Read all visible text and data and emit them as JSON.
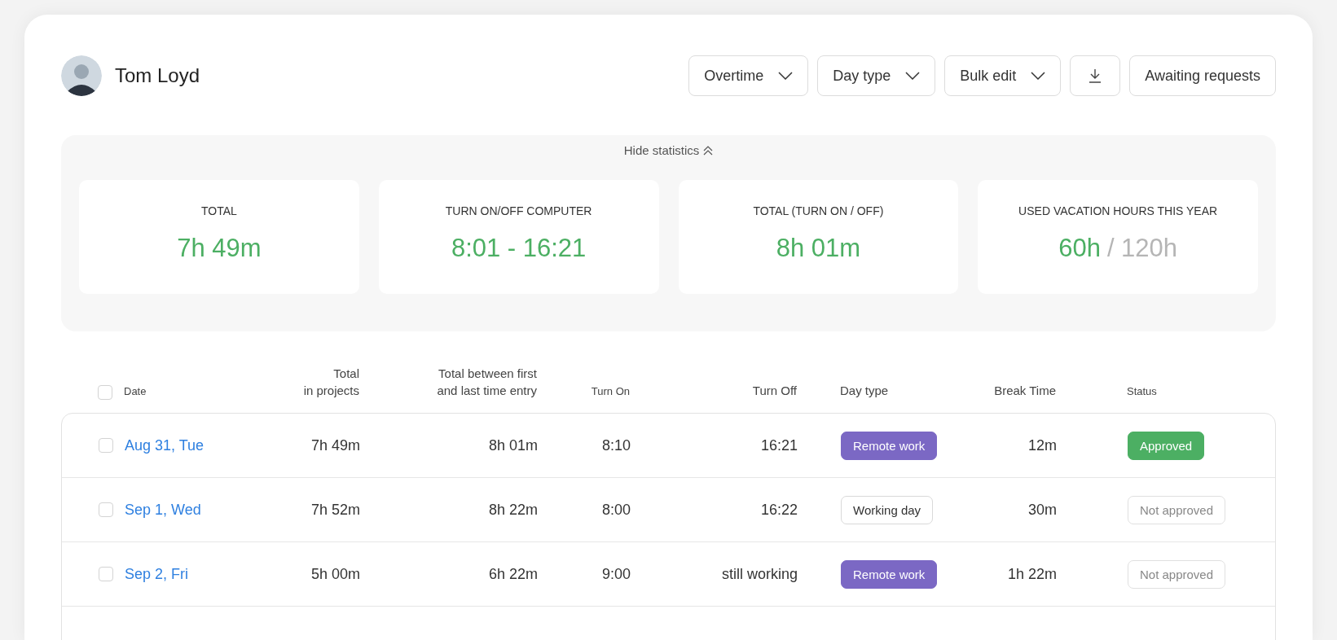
{
  "user": {
    "name": "Tom Loyd"
  },
  "toolbar": [
    {
      "kind": "dropdown",
      "label": "Overtime"
    },
    {
      "kind": "dropdown",
      "label": "Day type"
    },
    {
      "kind": "dropdown",
      "label": "Bulk edit"
    },
    {
      "kind": "download"
    },
    {
      "kind": "plain",
      "label": "Awaiting requests"
    }
  ],
  "statistics": {
    "toggle": "Hide statistics",
    "expanded": true,
    "cards": [
      {
        "label": "TOTAL",
        "value": "7h 49m"
      },
      {
        "label": "TURN ON/OFF COMPUTER",
        "value": "8:01 - 16:21"
      },
      {
        "label": "TOTAL (TURN ON / OFF)",
        "value": "8h 01m"
      },
      {
        "label": "USED VACATION HOURS THIS YEAR",
        "value": "60h",
        "total": "/ 120h"
      }
    ]
  },
  "table": {
    "select_all": {
      "checked": false
    },
    "columns": [
      "Date",
      "Total\nin projects",
      "Total between first\nand last time entry",
      "Turn On",
      "Turn Off",
      "Day type",
      "Break Time",
      "Status"
    ],
    "rows": [
      {
        "checked": false,
        "date": "Aug 31, Tue",
        "in_projects": "7h 49m",
        "between": "8h 01m",
        "turn_on": "8:10",
        "turn_off": "16:21",
        "day_type": {
          "kind": "remote",
          "label": "Remote work"
        },
        "break_time": "12m",
        "status": {
          "kind": "approved",
          "label": "Approved"
        }
      },
      {
        "checked": false,
        "date": "Sep 1, Wed",
        "in_projects": "7h 52m",
        "between": "8h 22m",
        "turn_on": "8:00",
        "turn_off": "16:22",
        "day_type": {
          "kind": "working",
          "label": "Working day"
        },
        "break_time": "30m",
        "status": {
          "kind": "pending",
          "label": "Not approved"
        }
      },
      {
        "checked": false,
        "date": "Sep 2, Fri",
        "in_projects": "5h 00m",
        "between": "6h 22m",
        "turn_on": "9:00",
        "turn_off": "still working",
        "day_type": {
          "kind": "remote",
          "label": "Remote work"
        },
        "break_time": "1h 22m",
        "status": {
          "kind": "pending",
          "label": "Not approved"
        }
      }
    ]
  }
}
